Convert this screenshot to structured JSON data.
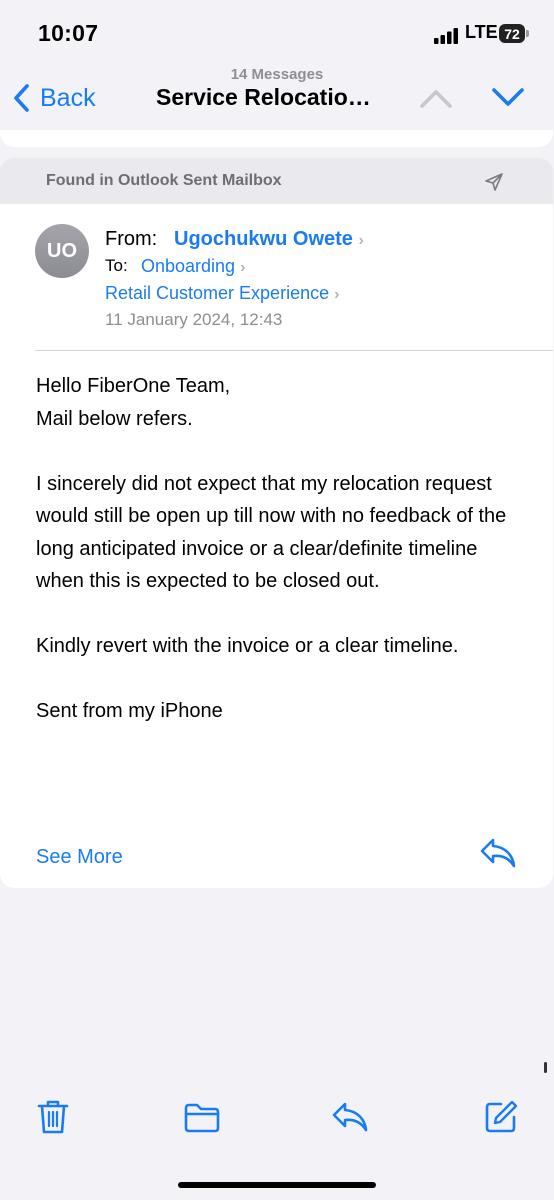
{
  "status_bar": {
    "time": "10:07",
    "network": "LTE",
    "battery": "72"
  },
  "nav": {
    "back_label": "Back",
    "message_count": "14 Messages",
    "title": "Service Relocatio…",
    "up_icon": "chevron-up-icon",
    "down_icon": "chevron-down-icon"
  },
  "email": {
    "found_in": "Found in Outlook Sent Mailbox",
    "avatar_initials": "UO",
    "from_label": "From:",
    "from_name": "Ugochukwu Owete",
    "to_label": "To:",
    "recipients": [
      "Onboarding",
      "Retail Customer Experience"
    ],
    "date": "11 January 2024, 12:43",
    "body": {
      "greeting": "Hello FiberOne Team,",
      "line2": "Mail below refers.",
      "para1": "I sincerely did not expect that my relocation request would still be open up till now with no feedback of the long anticipated invoice or a clear/definite timeline when this is expected to be closed out.",
      "para2": "Kindly revert with the invoice or a clear timeline.",
      "signature": "Sent from my iPhone"
    },
    "see_more_label": "See More"
  },
  "toolbar": {
    "items": [
      "trash-icon",
      "folder-icon",
      "reply-icon",
      "compose-icon"
    ]
  },
  "colors": {
    "accent": "#1a7cf2",
    "background": "#f2f2f7",
    "secondary_text": "#8e8e93"
  }
}
